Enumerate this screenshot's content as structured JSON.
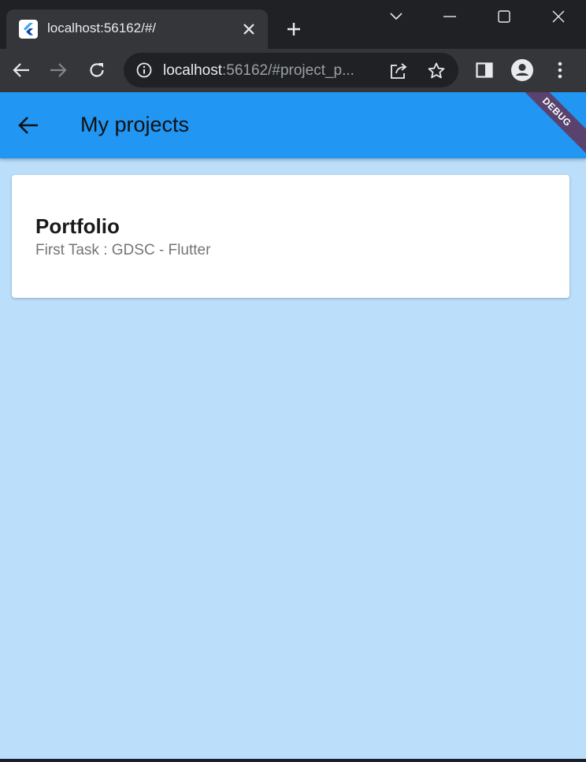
{
  "browser": {
    "tab": {
      "title": "localhost:56162/#/",
      "favicon": "flutter-logo-icon",
      "close_icon": "close-icon"
    },
    "new_tab_icon": "plus-icon",
    "window_controls": [
      "chevron-down-icon",
      "minimize-icon",
      "maximize-icon",
      "close-icon"
    ],
    "toolbar": {
      "back_icon": "arrow-left-icon",
      "forward_icon": "arrow-right-icon",
      "reload_icon": "reload-icon",
      "omnibox": {
        "host": "localhost",
        "rest": ":56162/#project_p...",
        "info_icon": "info-icon",
        "share_icon": "share-icon",
        "star_icon": "star-icon"
      },
      "side_panel_icon": "side-panel-icon",
      "profile_icon": "profile-icon",
      "menu_icon": "kebab-menu-icon"
    }
  },
  "app": {
    "appbar": {
      "title": "My projects",
      "back_icon": "arrow-back-icon",
      "color": "#2196f3"
    },
    "debug_banner": "DEBUG",
    "background_color": "#bbdefb",
    "projects": [
      {
        "title": "Portfolio",
        "subtitle": "First Task : GDSC - Flutter"
      }
    ]
  }
}
